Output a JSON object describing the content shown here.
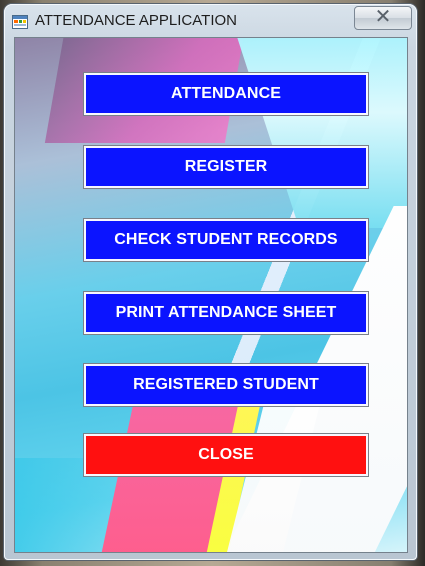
{
  "window": {
    "title": "ATTENDANCE APPLICATION",
    "close_symbol": "✕"
  },
  "icons": {
    "app": "application-icon",
    "close": "close-icon"
  },
  "buttons": [
    {
      "label": "ATTENDANCE",
      "color": "#0b14ff"
    },
    {
      "label": "REGISTER",
      "color": "#0b14ff"
    },
    {
      "label": "CHECK STUDENT RECORDS",
      "color": "#0b14ff"
    },
    {
      "label": "PRINT ATTENDANCE SHEET",
      "color": "#0b14ff"
    },
    {
      "label": "REGISTERED STUDENT",
      "color": "#0b14ff"
    },
    {
      "label": "CLOSE",
      "color": "#ff1010"
    }
  ]
}
